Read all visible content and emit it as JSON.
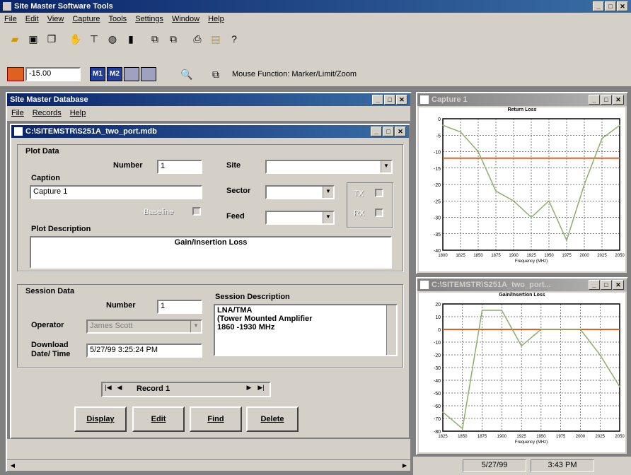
{
  "app": {
    "title": "Site Master Software Tools",
    "menus": [
      "File",
      "Edit",
      "View",
      "Capture",
      "Tools",
      "Settings",
      "Window",
      "Help"
    ]
  },
  "toolbar2": {
    "value": "-15.00",
    "mouse_function": "Mouse Function: Marker/Limit/Zoom",
    "m1": "M1",
    "m2": "M2"
  },
  "db": {
    "title": "Site Master Database",
    "menus": [
      "File",
      "Records",
      "Help"
    ],
    "doc_title": "C:\\SITEMSTR\\S251A_two_port.mdb",
    "plot": {
      "section": "Plot Data",
      "number_label": "Number",
      "number": "1",
      "caption_label": "Caption",
      "caption": "Capture 1",
      "baseline_label": "Baseline",
      "desc_label": "Plot Description",
      "description": "Gain/Insertion Loss",
      "site_label": "Site",
      "sector_label": "Sector",
      "feed_label": "Feed",
      "tx_label": "TX",
      "rx_label": "RX"
    },
    "session": {
      "section": "Session Data",
      "number_label": "Number",
      "number": "1",
      "operator_label": "Operator",
      "operator": "James Scott",
      "download_label1": "Download",
      "download_label2": "Date/ Time",
      "download": "5/27/99 3:25:24 PM",
      "desc_label": "Session Description",
      "desc_lines": [
        "LNA/TMA",
        "(Tower Mounted Amplifier",
        "1860 -1930 MHz"
      ]
    },
    "record": "Record 1",
    "buttons": {
      "display": "Display",
      "edit": "Edit",
      "find": "Find",
      "delete": "Delete"
    }
  },
  "chart_windows": {
    "top_title": "Capture 1",
    "bottom_title": "C:\\SITEMSTR\\S251A_two_port...",
    "top_chart_title": "Return Loss",
    "bottom_chart_title": "Gain/Insertion Loss",
    "x_label": "Frequency (MHz)"
  },
  "status": {
    "date": "5/27/99",
    "time": "3:43 PM"
  },
  "chart_data": [
    {
      "type": "line",
      "title": "Return Loss",
      "xlabel": "Frequency (MHz)",
      "x": [
        1800,
        1825,
        1850,
        1875,
        1900,
        1925,
        1950,
        1975,
        2000,
        2025,
        2050
      ],
      "yticks": [
        0,
        -5,
        -10,
        -15,
        -20,
        -25,
        -30,
        -35,
        -40
      ],
      "ylim": [
        -40,
        0
      ],
      "series": [
        {
          "values": [
            -2,
            -4,
            -10,
            -22,
            -25,
            -30,
            -25,
            -37,
            -20,
            -6,
            -2
          ]
        }
      ],
      "limit": -12
    },
    {
      "type": "line",
      "title": "Gain/Insertion Loss",
      "xlabel": "Frequency (MHz)",
      "x": [
        1825,
        1850,
        1875,
        1900,
        1925,
        1950,
        1975,
        2000,
        2025,
        2050
      ],
      "yticks": [
        20,
        10,
        0,
        -10,
        -20,
        -30,
        -40,
        -50,
        -60,
        -70,
        -80
      ],
      "ylim": [
        -80,
        20
      ],
      "series": [
        {
          "values": [
            -65,
            -78,
            15,
            15,
            -13,
            0,
            0,
            0,
            -20,
            -45
          ]
        }
      ],
      "limit": 0
    }
  ]
}
